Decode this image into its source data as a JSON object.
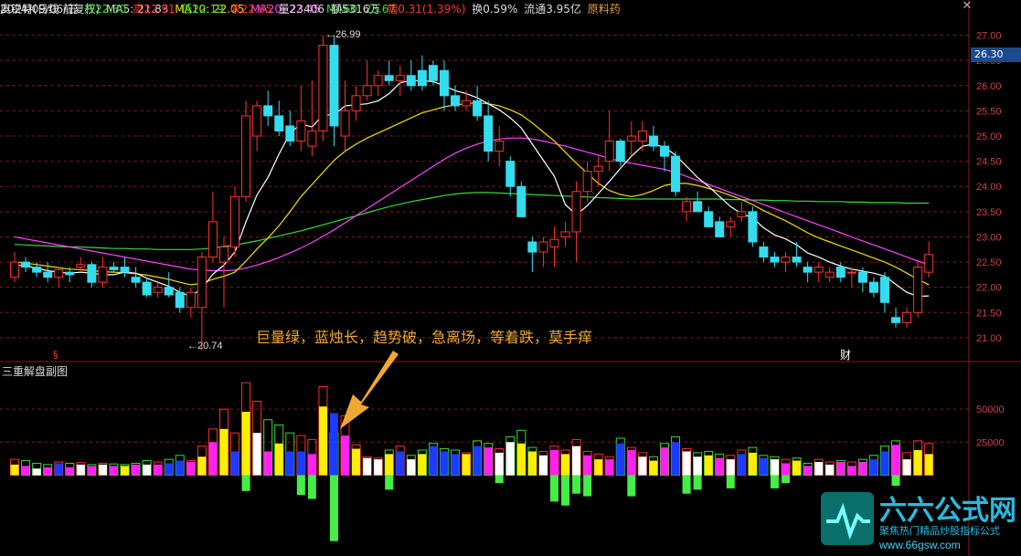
{
  "header": {
    "name": "奥锐特(日线 前复权)",
    "ma5": "MA5: 21.83",
    "ma10": "MA10: 22.05",
    "ma20": "MA20: 22.45",
    "ma60": "MA60: 23.67",
    "date": "2024/09/06/五",
    "open": "开22.30",
    "high": "高22.91",
    "low": "低22.19",
    "close": "收22.65",
    "volume": "量23406",
    "amount": "额5316万",
    "change": "幅0.31(1.39%)",
    "turnover": "换0.59%",
    "float_cap": "流通3.95亿",
    "sector": "原料药"
  },
  "price_axis": {
    "ticks": [
      "27.00",
      "26.50",
      "26.00",
      "25.50",
      "25.00",
      "24.50",
      "24.00",
      "23.50",
      "23.00",
      "22.50",
      "22.00",
      "21.50",
      "21.00"
    ],
    "current_price": "26.30"
  },
  "annotations": {
    "high_label": "26.99",
    "low_label": "20.74",
    "note": "巨量绿，蓝烛长，趋势破，急离场，等着跌，莫手痒",
    "event_marker": "财",
    "left_marker": "§"
  },
  "indicator": {
    "title": "三重解盘副图",
    "ticks": [
      "50000",
      "25000"
    ]
  },
  "watermark": {
    "brand": "六六公式网",
    "slogan": "聚焦热门精品炒股指标公式",
    "url": "www.66gsw.com"
  },
  "colors": {
    "up": "#ff3333",
    "down": "#33ddee",
    "ma5": "#ffffff",
    "ma10": "#f0e000",
    "ma20": "#ff44ff",
    "ma60": "#33dd33",
    "grid": "#8b1a1a",
    "axis_bg": "#1e4a8c"
  },
  "chart_data": {
    "type": "candlestick",
    "candles": [
      [
        22.2,
        22.7,
        22.1,
        22.5
      ],
      [
        22.5,
        22.6,
        22.3,
        22.4
      ],
      [
        22.4,
        22.5,
        22.2,
        22.3
      ],
      [
        22.3,
        22.5,
        22.1,
        22.2
      ],
      [
        22.2,
        22.4,
        22.0,
        22.35
      ],
      [
        22.3,
        22.4,
        22.1,
        22.25
      ],
      [
        22.4,
        22.6,
        22.3,
        22.45
      ],
      [
        22.45,
        22.5,
        22.0,
        22.1
      ],
      [
        22.1,
        22.6,
        22.0,
        22.4
      ],
      [
        22.4,
        22.5,
        22.3,
        22.35
      ],
      [
        22.4,
        22.6,
        22.2,
        22.3
      ],
      [
        22.2,
        22.4,
        22.0,
        22.1
      ],
      [
        22.1,
        22.2,
        21.8,
        21.85
      ],
      [
        21.9,
        22.1,
        21.8,
        22.0
      ],
      [
        22.0,
        22.3,
        21.8,
        21.85
      ],
      [
        21.9,
        22.0,
        21.5,
        21.6
      ],
      [
        21.6,
        22.0,
        21.4,
        21.9
      ],
      [
        21.6,
        22.7,
        20.74,
        22.6
      ],
      [
        22.6,
        23.9,
        22.5,
        23.3
      ],
      [
        22.5,
        23.0,
        21.6,
        22.8
      ],
      [
        22.8,
        24.0,
        22.6,
        23.8
      ],
      [
        23.8,
        25.7,
        23.7,
        25.4
      ],
      [
        25.0,
        25.7,
        24.7,
        25.6
      ],
      [
        25.6,
        25.9,
        25.2,
        25.4
      ],
      [
        25.4,
        25.7,
        25.0,
        25.1
      ],
      [
        25.2,
        25.5,
        24.8,
        24.9
      ],
      [
        24.9,
        26.0,
        24.7,
        25.3
      ],
      [
        24.8,
        26.1,
        24.6,
        25.1
      ],
      [
        25.1,
        26.99,
        24.9,
        26.8
      ],
      [
        26.8,
        27.0,
        24.8,
        25.2
      ],
      [
        25.0,
        26.1,
        24.7,
        25.5
      ],
      [
        25.5,
        26.0,
        25.3,
        25.8
      ],
      [
        25.8,
        26.5,
        25.7,
        26.0
      ],
      [
        26.0,
        26.3,
        25.8,
        26.2
      ],
      [
        26.2,
        26.5,
        26.0,
        26.1
      ],
      [
        26.1,
        26.4,
        25.8,
        26.2
      ],
      [
        26.2,
        26.5,
        25.9,
        26.0
      ],
      [
        26.3,
        26.6,
        25.9,
        26.0
      ],
      [
        26.4,
        26.5,
        26.0,
        26.1
      ],
      [
        26.3,
        26.5,
        25.5,
        25.8
      ],
      [
        25.8,
        26.0,
        25.5,
        25.6
      ],
      [
        25.6,
        25.9,
        25.5,
        25.7
      ],
      [
        25.7,
        26.0,
        25.3,
        25.4
      ],
      [
        25.4,
        25.7,
        24.5,
        24.7
      ],
      [
        24.7,
        25.2,
        24.4,
        24.9
      ],
      [
        24.5,
        24.6,
        23.8,
        24.0
      ],
      [
        24.0,
        24.1,
        23.4,
        23.4
      ],
      [
        22.9,
        23.0,
        22.3,
        22.7
      ],
      [
        22.7,
        23.0,
        22.4,
        22.9
      ],
      [
        22.8,
        23.2,
        22.4,
        22.95
      ],
      [
        23.0,
        23.3,
        22.8,
        23.1
      ],
      [
        23.1,
        24.1,
        22.5,
        23.9
      ],
      [
        23.9,
        24.5,
        23.7,
        24.3
      ],
      [
        24.3,
        24.6,
        24.0,
        24.4
      ],
      [
        24.5,
        25.5,
        24.3,
        24.9
      ],
      [
        24.9,
        24.95,
        24.4,
        24.5
      ],
      [
        24.9,
        25.3,
        24.6,
        25.0
      ],
      [
        24.9,
        25.3,
        24.7,
        25.1
      ],
      [
        25.0,
        25.2,
        24.7,
        24.8
      ],
      [
        24.8,
        24.9,
        24.3,
        24.6
      ],
      [
        24.6,
        24.7,
        23.8,
        23.9
      ],
      [
        23.5,
        23.8,
        23.3,
        23.7
      ],
      [
        23.7,
        23.9,
        23.5,
        23.5
      ],
      [
        23.5,
        23.6,
        23.2,
        23.2
      ],
      [
        23.3,
        23.4,
        23.0,
        23.0
      ],
      [
        23.2,
        23.4,
        23.0,
        23.3
      ],
      [
        23.4,
        23.7,
        23.3,
        23.5
      ],
      [
        23.5,
        23.6,
        22.8,
        22.9
      ],
      [
        22.8,
        22.9,
        22.5,
        22.6
      ],
      [
        22.6,
        22.7,
        22.4,
        22.5
      ],
      [
        22.5,
        22.7,
        22.3,
        22.6
      ],
      [
        22.6,
        22.9,
        22.4,
        22.5
      ],
      [
        22.4,
        22.5,
        22.1,
        22.3
      ],
      [
        22.3,
        22.5,
        22.1,
        22.4
      ],
      [
        22.2,
        22.4,
        22.1,
        22.3
      ],
      [
        22.4,
        22.5,
        22.1,
        22.2
      ],
      [
        22.3,
        22.4,
        22.0,
        22.3
      ],
      [
        22.3,
        22.4,
        21.9,
        22.1
      ],
      [
        22.1,
        22.2,
        21.8,
        21.9
      ],
      [
        22.2,
        22.3,
        21.5,
        21.7
      ],
      [
        21.4,
        21.6,
        21.2,
        21.3
      ],
      [
        21.3,
        21.6,
        21.2,
        21.5
      ],
      [
        21.5,
        22.5,
        21.4,
        22.4
      ],
      [
        22.3,
        22.91,
        22.19,
        22.65
      ]
    ],
    "ma5": [
      22.45,
      22.42,
      22.38,
      22.33,
      22.3,
      22.28,
      22.3,
      22.28,
      22.25,
      22.25,
      22.3,
      22.28,
      22.18,
      22.1,
      22.02,
      21.9,
      21.82,
      21.98,
      22.26,
      22.44,
      22.7,
      23.3,
      23.83,
      24.18,
      24.64,
      25.06,
      25.24,
      25.18,
      25.42,
      25.42,
      25.6,
      25.62,
      25.64,
      25.7,
      25.84,
      26.06,
      26.1,
      26.1,
      26.08,
      26.0,
      25.9,
      25.84,
      25.76,
      25.64,
      25.52,
      25.36,
      25.16,
      24.84,
      24.52,
      24.2,
      23.64,
      23.44,
      23.62,
      23.86,
      24.1,
      24.36,
      24.6,
      24.8,
      24.84,
      24.78,
      24.62,
      24.4,
      24.18,
      24.0,
      23.8,
      23.6,
      23.46,
      23.38,
      23.18,
      23.04,
      22.96,
      22.84,
      22.68,
      22.6,
      22.5,
      22.42,
      22.36,
      22.32,
      22.28,
      22.22,
      22.06,
      21.9,
      21.82,
      21.83
    ],
    "ma10": [
      22.5,
      22.48,
      22.45,
      22.42,
      22.39,
      22.36,
      22.35,
      22.33,
      22.31,
      22.3,
      22.29,
      22.27,
      22.24,
      22.2,
      22.16,
      22.1,
      22.05,
      22.08,
      22.16,
      22.22,
      22.3,
      22.52,
      22.76,
      22.98,
      23.22,
      23.5,
      23.8,
      24.04,
      24.28,
      24.52,
      24.7,
      24.84,
      24.96,
      25.06,
      25.16,
      25.26,
      25.36,
      25.46,
      25.52,
      25.58,
      25.62,
      25.64,
      25.66,
      25.64,
      25.6,
      25.52,
      25.42,
      25.26,
      25.08,
      24.9,
      24.68,
      24.46,
      24.26,
      24.06,
      23.92,
      23.84,
      23.8,
      23.84,
      23.92,
      24.02,
      24.06,
      24.06,
      24.02,
      23.96,
      23.9,
      23.82,
      23.74,
      23.64,
      23.52,
      23.42,
      23.32,
      23.2,
      23.08,
      22.98,
      22.9,
      22.82,
      22.74,
      22.66,
      22.58,
      22.5,
      22.4,
      22.28,
      22.16,
      22.05
    ],
    "ma20": [
      23.0,
      22.96,
      22.92,
      22.88,
      22.84,
      22.8,
      22.76,
      22.72,
      22.68,
      22.64,
      22.6,
      22.56,
      22.52,
      22.48,
      22.44,
      22.4,
      22.36,
      22.34,
      22.33,
      22.33,
      22.34,
      22.38,
      22.44,
      22.51,
      22.59,
      22.68,
      22.78,
      22.89,
      23.01,
      23.14,
      23.28,
      23.42,
      23.56,
      23.7,
      23.84,
      23.98,
      24.12,
      24.26,
      24.4,
      24.54,
      24.66,
      24.76,
      24.84,
      24.9,
      24.94,
      24.96,
      24.96,
      24.94,
      24.9,
      24.85,
      24.8,
      24.74,
      24.68,
      24.62,
      24.56,
      24.5,
      24.46,
      24.42,
      24.38,
      24.34,
      24.28,
      24.2,
      24.12,
      24.04,
      23.96,
      23.88,
      23.8,
      23.72,
      23.64,
      23.56,
      23.48,
      23.4,
      23.32,
      23.24,
      23.16,
      23.08,
      23.0,
      22.92,
      22.84,
      22.76,
      22.68,
      22.6,
      22.52,
      22.45
    ],
    "ma60": [
      22.85,
      22.84,
      22.83,
      22.82,
      22.81,
      22.8,
      22.8,
      22.79,
      22.78,
      22.77,
      22.77,
      22.76,
      22.76,
      22.75,
      22.75,
      22.75,
      22.75,
      22.76,
      22.78,
      22.81,
      22.84,
      22.88,
      22.92,
      22.97,
      23.02,
      23.07,
      23.12,
      23.18,
      23.24,
      23.3,
      23.36,
      23.42,
      23.48,
      23.54,
      23.6,
      23.65,
      23.7,
      23.74,
      23.78,
      23.82,
      23.85,
      23.87,
      23.88,
      23.88,
      23.87,
      23.86,
      23.85,
      23.84,
      23.83,
      23.82,
      23.81,
      23.8,
      23.79,
      23.78,
      23.77,
      23.76,
      23.75,
      23.75,
      23.75,
      23.75,
      23.75,
      23.75,
      23.75,
      23.75,
      23.75,
      23.74,
      23.74,
      23.73,
      23.73,
      23.72,
      23.72,
      23.71,
      23.71,
      23.7,
      23.7,
      23.7,
      23.69,
      23.69,
      23.68,
      23.68,
      23.68,
      23.67,
      23.67,
      23.67
    ],
    "volume_outline": [
      12000,
      11000,
      9000,
      8000,
      10000,
      9000,
      9500,
      8000,
      9000,
      8500,
      8000,
      9000,
      11000,
      10000,
      12000,
      15000,
      11000,
      22000,
      35000,
      50000,
      32000,
      70000,
      56000,
      42000,
      38000,
      32000,
      30000,
      27000,
      67000,
      32000,
      45000,
      23000,
      14000,
      13000,
      19000,
      22000,
      15000,
      19000,
      24000,
      20000,
      19000,
      17000,
      26000,
      24000,
      20000,
      29000,
      34000,
      21000,
      18000,
      22000,
      19000,
      27000,
      18000,
      16000,
      14000,
      28000,
      21000,
      17000,
      14000,
      24000,
      29000,
      20000,
      17000,
      18000,
      16000,
      15000,
      19000,
      21000,
      15000,
      14000,
      12000,
      13000,
      9000,
      12000,
      10000,
      11000,
      10000,
      12000,
      15000,
      22000,
      26000,
      17000,
      26000,
      24000
    ],
    "volume_fill": [
      8000,
      7000,
      5000,
      6000,
      9000,
      6000,
      8000,
      7000,
      8000,
      7000,
      7000,
      8000,
      8000,
      8000,
      9000,
      11000,
      10000,
      14000,
      25000,
      35000,
      18000,
      48000,
      32000,
      18000,
      24000,
      18000,
      18000,
      16000,
      52000,
      47000,
      30000,
      20000,
      13000,
      12000,
      16000,
      18000,
      12000,
      16000,
      22000,
      18000,
      16000,
      16000,
      22000,
      21000,
      17000,
      25000,
      24000,
      18000,
      15000,
      19000,
      16000,
      22000,
      15000,
      12000,
      12000,
      24000,
      19000,
      14000,
      11000,
      21000,
      25000,
      18000,
      14000,
      15000,
      13000,
      12000,
      16000,
      17000,
      13000,
      12000,
      9000,
      11000,
      7000,
      10000,
      8000,
      10000,
      7000,
      10000,
      12000,
      18000,
      23000,
      12000,
      19000,
      16000
    ],
    "volume_fill_colors": [
      "y",
      "m",
      "w",
      "m",
      "b",
      "m",
      "w",
      "m",
      "w",
      "m",
      "y",
      "m",
      "w",
      "m",
      "b",
      "b",
      "m",
      "y",
      "m",
      "y",
      "b",
      "y",
      "w",
      "m",
      "y",
      "b",
      "b",
      "m",
      "y",
      "b",
      "m",
      "y",
      "w",
      "w",
      "y",
      "b",
      "w",
      "y",
      "b",
      "b",
      "b",
      "y",
      "b",
      "m",
      "w",
      "w",
      "y",
      "y",
      "w",
      "m",
      "y",
      "w",
      "m",
      "y",
      "m",
      "b",
      "m",
      "w",
      "y",
      "m",
      "b",
      "w",
      "w",
      "y",
      "m",
      "w",
      "b",
      "y",
      "b",
      "w",
      "m",
      "y",
      "m",
      "w",
      "w",
      "m",
      "m",
      "m",
      "b",
      "b",
      "m",
      "w",
      "y",
      "y"
    ],
    "volume_neg": [
      0,
      0,
      0,
      0,
      0,
      0,
      0,
      0,
      0,
      0,
      0,
      0,
      0,
      0,
      0,
      0,
      0,
      0,
      0,
      0,
      0,
      -12000,
      0,
      0,
      0,
      0,
      -15000,
      -18000,
      0,
      -50000,
      0,
      0,
      0,
      0,
      -11000,
      0,
      0,
      0,
      0,
      0,
      0,
      0,
      0,
      0,
      -6000,
      0,
      0,
      0,
      0,
      -20000,
      -23000,
      -14000,
      -16000,
      0,
      0,
      0,
      -16000,
      0,
      0,
      0,
      0,
      -14000,
      -11000,
      0,
      0,
      -10000,
      0,
      0,
      0,
      -10000,
      -6000,
      0,
      0,
      0,
      0,
      0,
      0,
      0,
      0,
      0,
      -8000,
      0,
      0,
      0
    ],
    "ylim_price": [
      20.6,
      27.3
    ],
    "ylim_volume": [
      -55000,
      75000
    ]
  }
}
